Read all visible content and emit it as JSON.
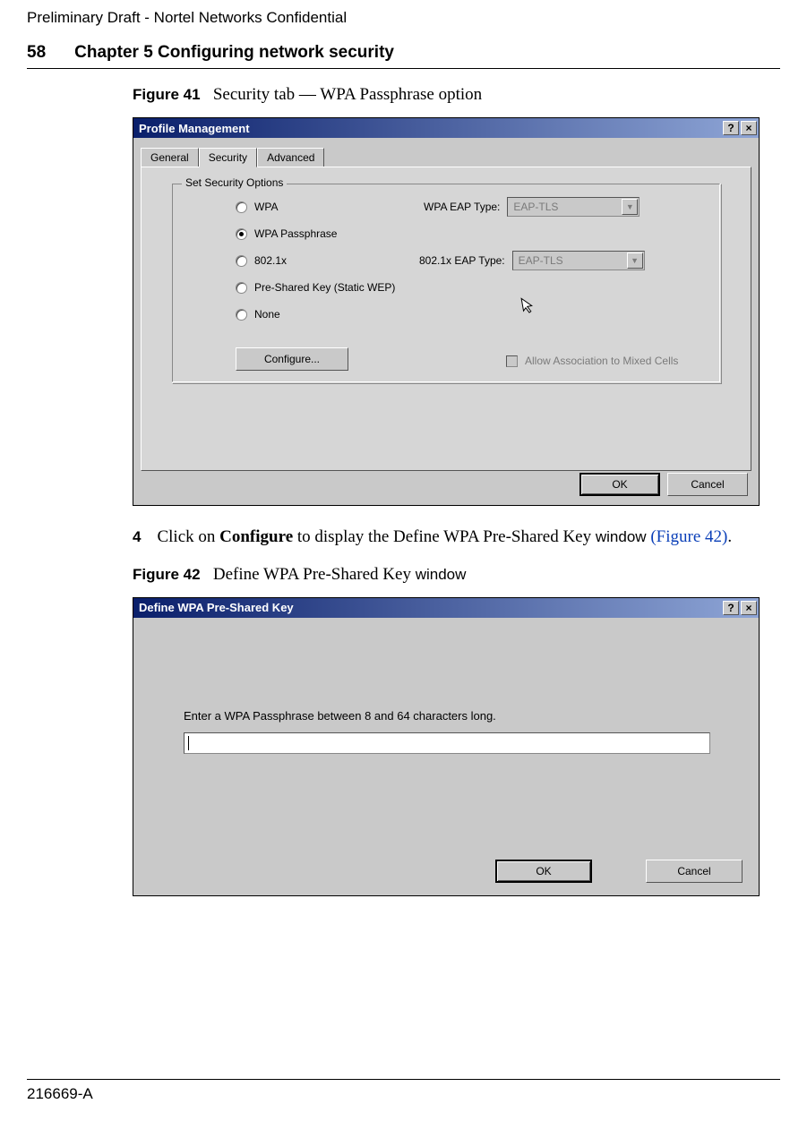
{
  "header": {
    "confidential": "Preliminary Draft - Nortel Networks Confidential",
    "page_num": "58",
    "chapter": "Chapter 5 Configuring network security"
  },
  "figure41": {
    "num": "Figure 41",
    "caption": "Security tab — WPA Passphrase option"
  },
  "dlg1": {
    "title": "Profile Management",
    "tabs": {
      "general": "General",
      "security": "Security",
      "advanced": "Advanced"
    },
    "group_label": "Set Security Options",
    "radios": {
      "wpa": "WPA",
      "wpa_pass": "WPA Passphrase",
      "dot1x": "802.1x",
      "psk": "Pre-Shared Key (Static WEP)",
      "none": "None"
    },
    "combo1": {
      "label": "WPA EAP Type:",
      "value": "EAP-TLS"
    },
    "combo2": {
      "label": "802.1x EAP Type:",
      "value": "EAP-TLS"
    },
    "configure": "Configure...",
    "allow_mixed": "Allow Association to Mixed Cells",
    "ok": "OK",
    "cancel": "Cancel"
  },
  "step4": {
    "num": "4",
    "pre": "Click on ",
    "bold": "Configure",
    "mid": " to display the Define WPA Pre-Shared Key ",
    "win": "window",
    "link": "(Figure 42)",
    "dot": "."
  },
  "figure42": {
    "num": "Figure 42",
    "caption": "Define WPA Pre-Shared Key ",
    "win": "window"
  },
  "dlg2": {
    "title": "Define WPA Pre-Shared Key",
    "label": "Enter a WPA Passphrase between 8 and 64 characters long.",
    "ok": "OK",
    "cancel": "Cancel"
  },
  "footer": {
    "doc_id": "216669-A"
  }
}
